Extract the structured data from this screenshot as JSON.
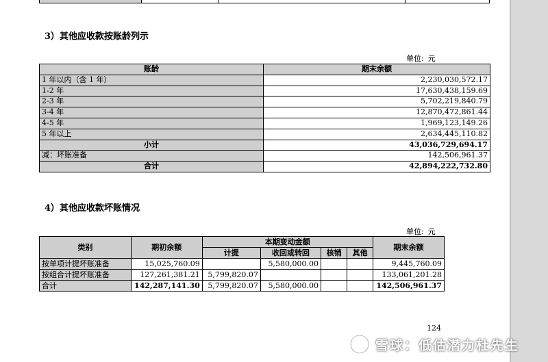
{
  "doc": {
    "section3": {
      "heading": "3）其他应收款按账龄列示",
      "unit_label": "单位:",
      "unit_value": "元",
      "headers": {
        "age": "账龄",
        "ending": "期末余额"
      },
      "rows": [
        {
          "label": "1 年以内（含 1 年）",
          "value": "2,230,030,572.17"
        },
        {
          "label": "1-2 年",
          "value": "17,630,438,159.69"
        },
        {
          "label": "2-3 年",
          "value": "5,702,219,840.79"
        },
        {
          "label": "3-4 年",
          "value": "12,870,472,861.44"
        },
        {
          "label": "4-5 年",
          "value": "1,969,123,149.26"
        },
        {
          "label": "5 年以上",
          "value": "2,634,445,110.82"
        }
      ],
      "subtotal": {
        "label": "小计",
        "value": "43,036,729,694.17"
      },
      "less": {
        "label": "减：坏账准备",
        "value": "142,506,961.37"
      },
      "total": {
        "label": "合计",
        "value": "42,894,222,732.80"
      }
    },
    "section4": {
      "heading": "4）其他应收款坏账情况",
      "unit_label": "单位:",
      "unit_value": "元",
      "headers": {
        "category": "类别",
        "beginning": "期初余额",
        "change_group": "本期变动金额",
        "accrual": "计提",
        "recovery": "收回或转回",
        "writeoff": "核销",
        "other": "其他",
        "ending": "期末余额"
      },
      "rows": [
        {
          "category": "按单项计提坏账准备",
          "beginning": "15,025,760.09",
          "accrual": "",
          "recovery": "5,580,000.00",
          "writeoff": "",
          "other": "",
          "ending": "9,445,760.09"
        },
        {
          "category": "按组合计提坏账准备",
          "beginning": "127,261,381.21",
          "accrual": "5,799,820.07",
          "recovery": "",
          "writeoff": "",
          "other": "",
          "ending": "133,061,201.28"
        },
        {
          "category": "合计",
          "beginning": "142,287,141.30",
          "accrual": "5,799,820.07",
          "recovery": "5,580,000.00",
          "writeoff": "",
          "other": "",
          "ending": "142,506,961.37"
        }
      ]
    },
    "page_number": "124"
  },
  "watermark": {
    "text": "雪球：低估潜力杜先生",
    "icon": "snowball-logo-icon"
  },
  "colors": {
    "header_gray": "#cfcfcf",
    "sidebar_gray": "#d9d9d9"
  }
}
